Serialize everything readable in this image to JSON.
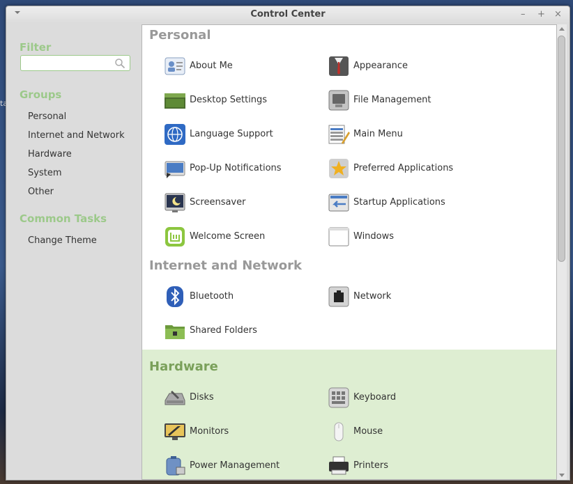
{
  "window": {
    "title": "Control Center",
    "buttons": {
      "minimize": "–",
      "maximize": "+",
      "close": "×"
    }
  },
  "desktop": {
    "edge_text": "ta"
  },
  "sidebar": {
    "filter_heading": "Filter",
    "filter_value": "",
    "groups_heading": "Groups",
    "groups": [
      "Personal",
      "Internet and Network",
      "Hardware",
      "System",
      "Other"
    ],
    "tasks_heading": "Common Tasks",
    "tasks": [
      "Change Theme"
    ]
  },
  "sections": {
    "personal": {
      "title": "Personal",
      "items": [
        "About Me",
        "Appearance",
        "Desktop Settings",
        "File Management",
        "Language Support",
        "Main Menu",
        "Pop-Up Notifications",
        "Preferred Applications",
        "Screensaver",
        "Startup Applications",
        "Welcome Screen",
        "Windows"
      ]
    },
    "internet": {
      "title": "Internet and Network",
      "items": [
        "Bluetooth",
        "Network",
        "Shared Folders"
      ]
    },
    "hardware": {
      "title": "Hardware",
      "items": [
        "Disks",
        "Keyboard",
        "Monitors",
        "Mouse",
        "Power Management",
        "Printers"
      ]
    }
  },
  "colors": {
    "accent_green": "#9cc98a",
    "hardware_highlight": "#deeed2",
    "hardware_title": "#7aa05a"
  }
}
